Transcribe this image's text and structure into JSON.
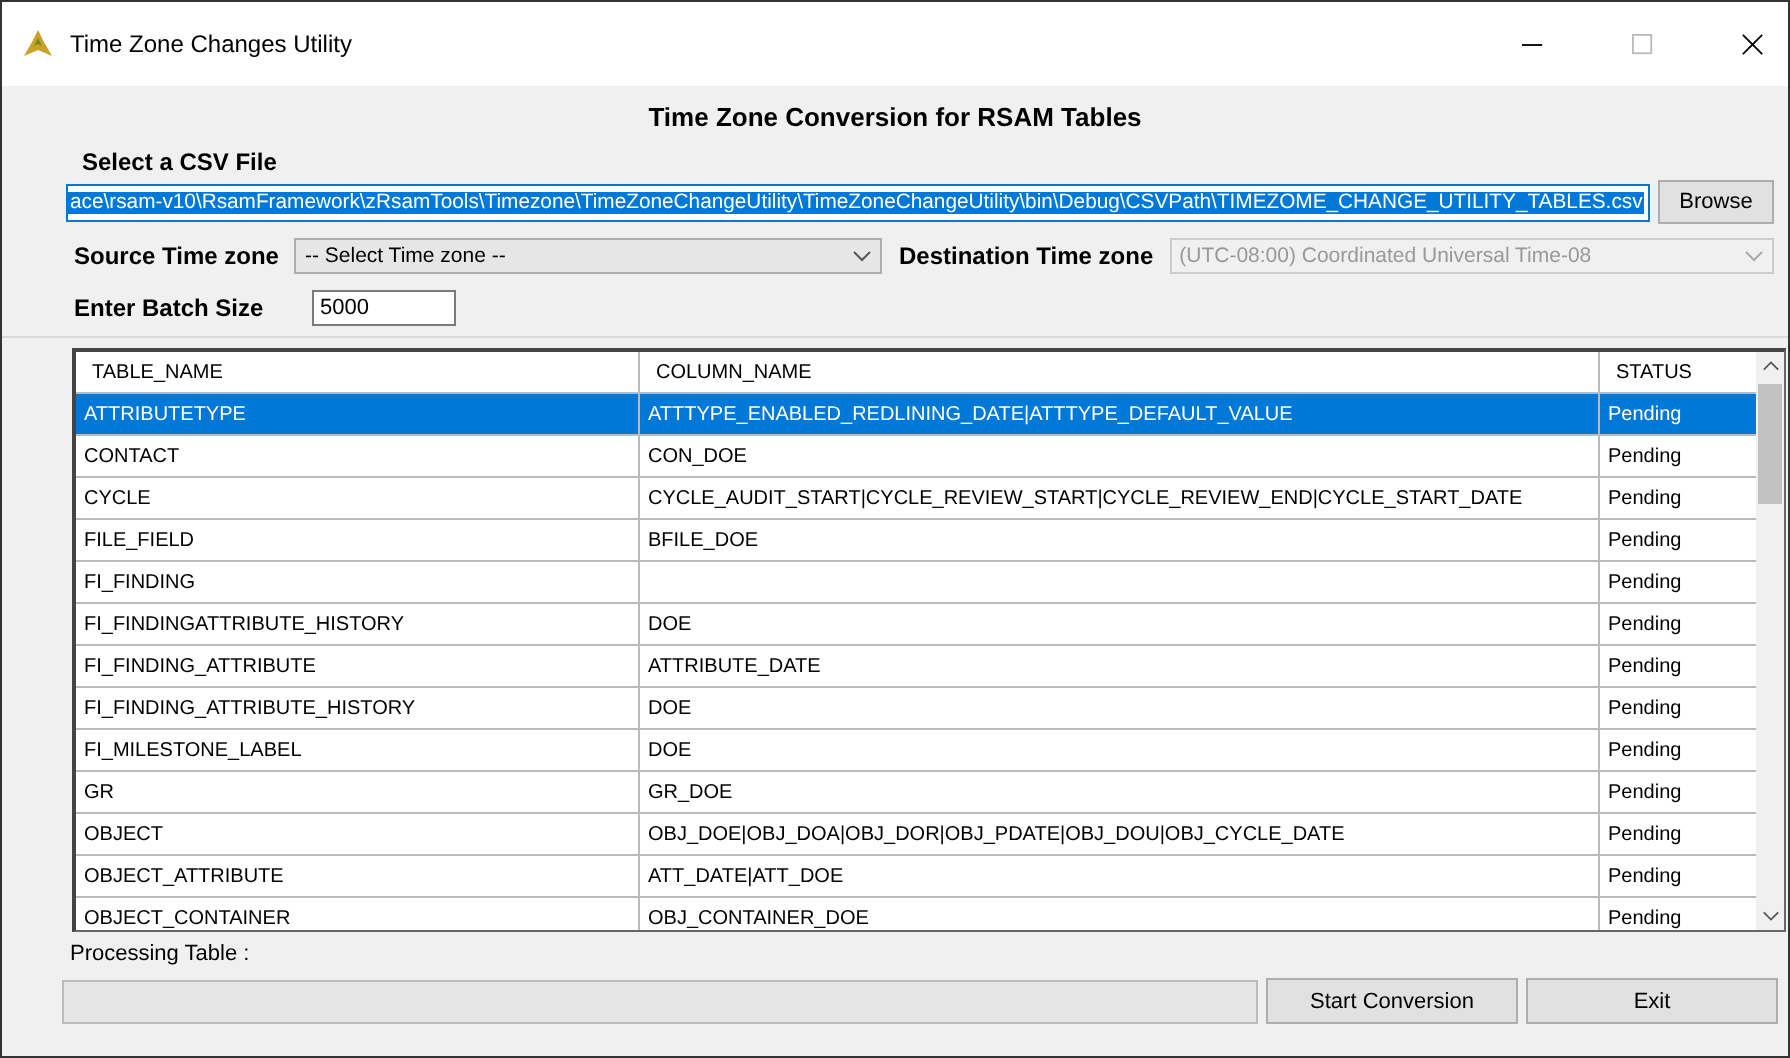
{
  "window": {
    "title": "Time Zone Changes Utility"
  },
  "heading": "Time Zone Conversion for RSAM Tables",
  "csv": {
    "label": "Select a CSV File",
    "value": "ace\\rsam-v10\\RsamFramework\\zRsamTools\\Timezone\\TimeZoneChangeUtility\\TimeZoneChangeUtility\\bin\\Debug\\CSVPath\\TIMEZOME_CHANGE_UTILITY_TABLES.csv",
    "button": "Browse"
  },
  "source": {
    "label": "Source Time zone",
    "value": "-- Select Time zone --",
    "disabled": false
  },
  "destination": {
    "label": "Destination Time zone",
    "value": "(UTC-08:00) Coordinated Universal Time-08",
    "disabled": true
  },
  "batch": {
    "label": "Enter Batch Size",
    "value": "5000"
  },
  "table": {
    "columns": [
      "TABLE_NAME",
      "COLUMN_NAME",
      "STATUS"
    ],
    "rows": [
      {
        "cells": [
          "ATTRIBUTETYPE",
          "ATTTYPE_ENABLED_REDLINING_DATE|ATTTYPE_DEFAULT_VALUE",
          "Pending"
        ],
        "selected": true
      },
      {
        "cells": [
          "CONTACT",
          "CON_DOE",
          "Pending"
        ],
        "selected": false
      },
      {
        "cells": [
          "CYCLE",
          "CYCLE_AUDIT_START|CYCLE_REVIEW_START|CYCLE_REVIEW_END|CYCLE_START_DATE",
          "Pending"
        ],
        "selected": false
      },
      {
        "cells": [
          "FILE_FIELD",
          "BFILE_DOE",
          "Pending"
        ],
        "selected": false
      },
      {
        "cells": [
          "FI_FINDING",
          "",
          "Pending"
        ],
        "selected": false
      },
      {
        "cells": [
          "FI_FINDINGATTRIBUTE_HISTORY",
          "DOE",
          "Pending"
        ],
        "selected": false
      },
      {
        "cells": [
          "FI_FINDING_ATTRIBUTE",
          "ATTRIBUTE_DATE",
          "Pending"
        ],
        "selected": false
      },
      {
        "cells": [
          "FI_FINDING_ATTRIBUTE_HISTORY",
          "DOE",
          "Pending"
        ],
        "selected": false
      },
      {
        "cells": [
          "FI_MILESTONE_LABEL",
          "DOE",
          "Pending"
        ],
        "selected": false
      },
      {
        "cells": [
          "GR",
          "GR_DOE",
          "Pending"
        ],
        "selected": false
      },
      {
        "cells": [
          "OBJECT",
          "OBJ_DOE|OBJ_DOA|OBJ_DOR|OBJ_PDATE|OBJ_DOU|OBJ_CYCLE_DATE",
          "Pending"
        ],
        "selected": false
      },
      {
        "cells": [
          "OBJECT_ATTRIBUTE",
          "ATT_DATE|ATT_DOE",
          "Pending"
        ],
        "selected": false
      },
      {
        "cells": [
          "OBJECT_CONTAINER",
          "OBJ_CONTAINER_DOE",
          "Pending"
        ],
        "selected": false
      }
    ]
  },
  "processing_label": "Processing Table :",
  "buttons": [
    "Start Conversion",
    "Exit"
  ]
}
